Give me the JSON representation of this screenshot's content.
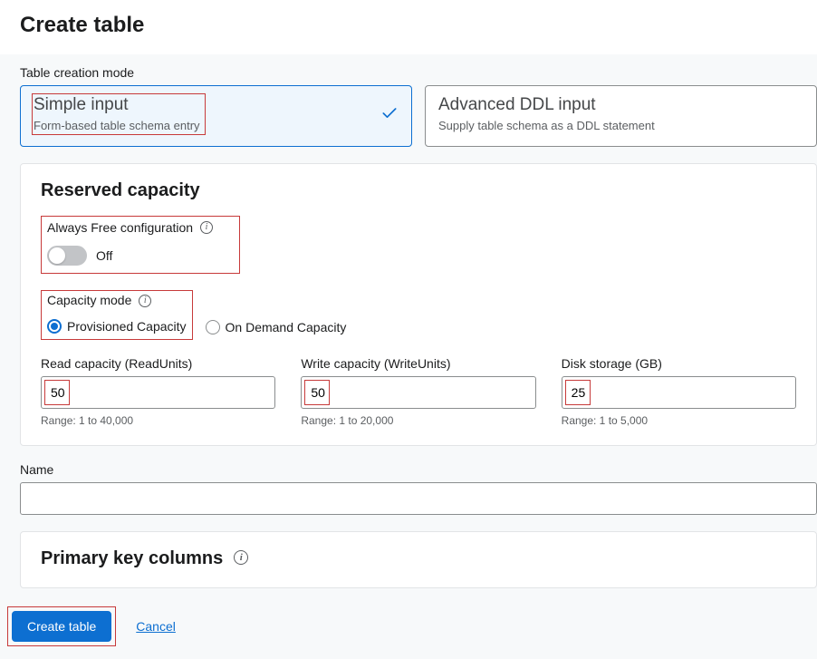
{
  "page": {
    "title": "Create table"
  },
  "creation_mode": {
    "label": "Table creation mode",
    "options": [
      {
        "title": "Simple input",
        "desc": "Form-based table schema entry",
        "selected": true
      },
      {
        "title": "Advanced DDL input",
        "desc": "Supply table schema as a DDL statement",
        "selected": false
      }
    ]
  },
  "reserved_capacity": {
    "heading": "Reserved capacity",
    "always_free": {
      "label": "Always Free configuration",
      "state_text": "Off",
      "on": false
    },
    "capacity_mode": {
      "label": "Capacity mode",
      "options": [
        {
          "label": "Provisioned Capacity",
          "selected": true
        },
        {
          "label": "On Demand Capacity",
          "selected": false
        }
      ]
    },
    "read": {
      "label": "Read capacity (ReadUnits)",
      "value": "50",
      "range": "Range: 1 to 40,000"
    },
    "write": {
      "label": "Write capacity (WriteUnits)",
      "value": "50",
      "range": "Range: 1 to 20,000"
    },
    "disk": {
      "label": "Disk storage (GB)",
      "value": "25",
      "range": "Range: 1 to 5,000"
    }
  },
  "name": {
    "label": "Name",
    "value": ""
  },
  "primary_key": {
    "heading": "Primary key columns"
  },
  "actions": {
    "create": "Create table",
    "cancel": "Cancel"
  }
}
